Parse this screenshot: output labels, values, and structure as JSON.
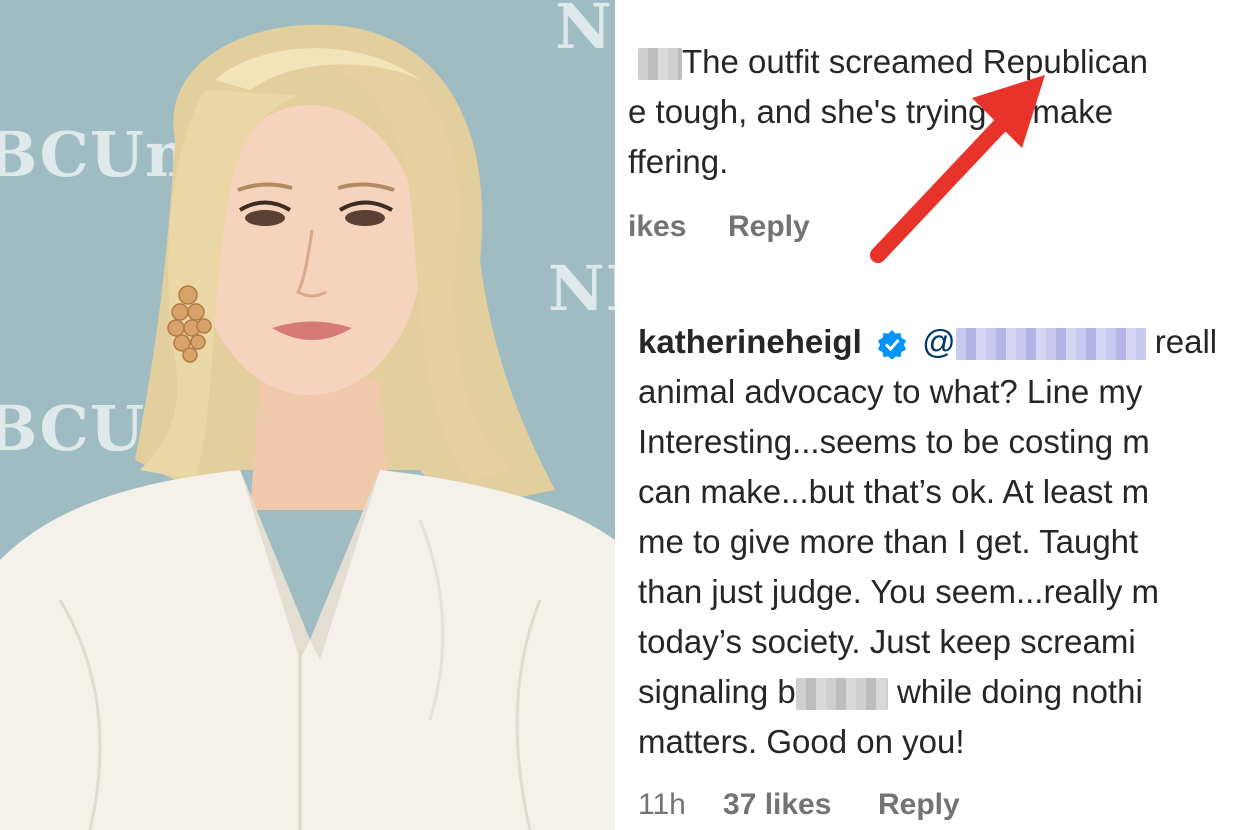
{
  "photo": {
    "backdrop_logos": [
      "NB",
      "BCUniv",
      "NB",
      "BCUniv"
    ]
  },
  "comment_top": {
    "lines": [
      "The outfit screamed Republican",
      "e tough, and she's trying to make",
      "ffering."
    ],
    "meta_likes": "ikes",
    "meta_reply": "Reply"
  },
  "comment_reply": {
    "username": "katherineheigl",
    "mention_prefix": "@",
    "first_line_end": "reall",
    "lines": [
      "animal advocacy to what? Line my",
      "Interesting...seems to be costing m",
      "can make...but that’s ok. At least m",
      "me to give more than I get. Taught",
      "than just judge. You seem...really m",
      "today’s society. Just keep screami",
      "matters. Good on you!"
    ],
    "signaling_prefix": "signaling b",
    "signaling_suffix": " while doing nothi",
    "time": "11h",
    "likes": "37 likes",
    "reply": "Reply"
  },
  "colors": {
    "arrow": "#e8332a",
    "verified_badge": "#0095f6",
    "backdrop": "#9fbcc2"
  }
}
